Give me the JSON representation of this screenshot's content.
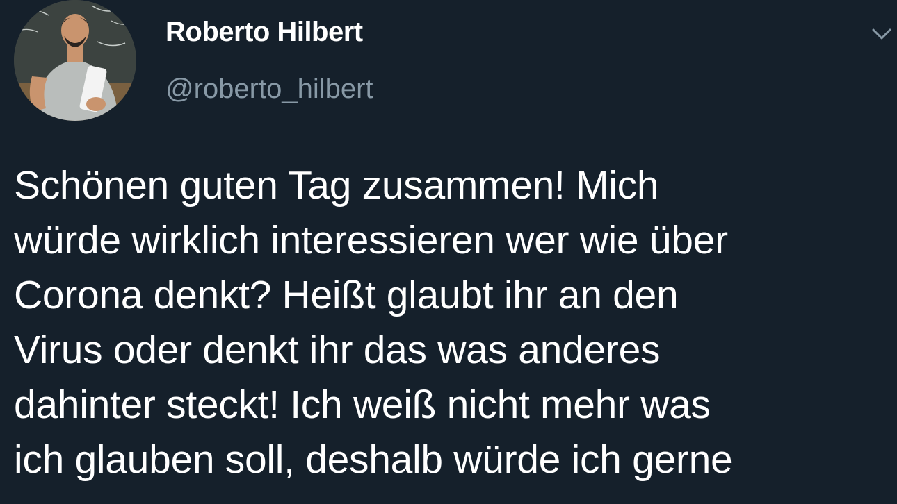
{
  "tweet": {
    "author": {
      "display_name": "Roberto Hilbert",
      "handle": "@roberto_hilbert",
      "avatar_icon": "profile-photo"
    },
    "more_icon": "chevron-down-icon",
    "text_lines": [
      "Schönen guten Tag zusammen! Mich",
      "würde wirklich interessieren wer wie über",
      "Corona denkt? Heißt glaubt ihr an den",
      "Virus oder denkt ihr das was anderes",
      "dahinter steckt! Ich weiß nicht mehr was",
      "ich glauben soll, deshalb würde ich gerne"
    ]
  },
  "colors": {
    "background": "#15202b",
    "text_primary": "#ffffff",
    "text_secondary": "#8899a6"
  }
}
